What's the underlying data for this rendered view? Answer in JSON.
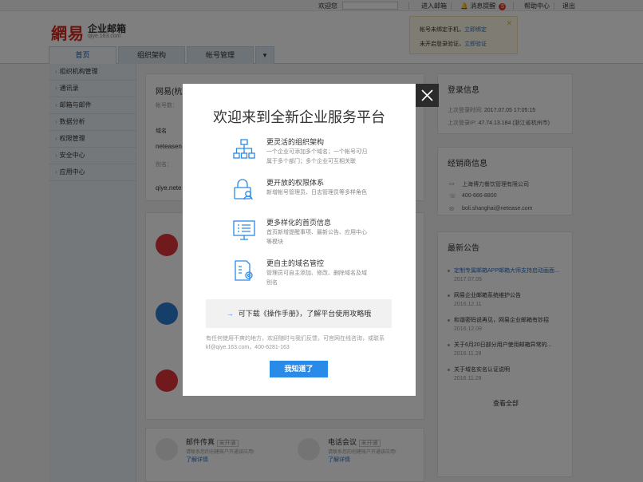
{
  "topbar": {
    "welcome": "欢迎您",
    "enter_mail": "进入邮箱",
    "messages": "消息提醒",
    "message_count": "5",
    "help": "帮助中心",
    "logout": "退出"
  },
  "logo": {
    "mark": "網易",
    "name": "企业邮箱",
    "domain": "qiye.163.com"
  },
  "notice": {
    "line1_text": "帐号未绑定手机，",
    "line1_link": "立即绑定",
    "line2_text": "未开启登录验证，",
    "line2_link": "立即验证",
    "close": "✕"
  },
  "nav": {
    "tabs": [
      "首页",
      "组织架构",
      "帐号管理"
    ],
    "more": "▾"
  },
  "sidebar": {
    "items": [
      {
        "label": "组织机构管理"
      },
      {
        "label": "通讯录"
      },
      {
        "label": "邮箱与邮件"
      },
      {
        "label": "数据分析"
      },
      {
        "label": "权限管理"
      },
      {
        "label": "安全中心"
      },
      {
        "label": "应用中心"
      }
    ]
  },
  "main": {
    "company_name": "网易(杭",
    "account_label": "帐号数：",
    "domain_label": "域名",
    "domain_value": "neteasen",
    "alias_label": "别名：",
    "qiye_text": "qiye.nete",
    "bottom_apps": [
      {
        "name": "邮件传真",
        "status": "未开通",
        "desc": "请联系您的创建账户开通该应用!",
        "link": "了解详情"
      },
      {
        "name": "电话会议",
        "status": "未开通",
        "desc": "请联系您的创建账户开通该应用!",
        "link": "了解详情"
      }
    ]
  },
  "login_info": {
    "title": "登录信息",
    "last_time_label": "上次登录时间: ",
    "last_time": "2017.07.05  17:05:15",
    "last_ip_label": "上次登录IP: ",
    "last_ip": "47.74.13.184 (浙江省杭州市)"
  },
  "dealer": {
    "title": "经销商信息",
    "company": "上海博力餐饮管理有限公司",
    "phone": "400-666-8800",
    "email": "boli.shanghai@netease.com"
  },
  "announcements": {
    "title": "最新公告",
    "items": [
      {
        "title": "定制专属邮箱APP邮箱大师支持启动画面...",
        "date": "2017.07.05",
        "highlight": true
      },
      {
        "title": "网易企业邮箱系统维护公告",
        "date": "2016.12.11",
        "highlight": false
      },
      {
        "title": "和谐密码说再见，网易企业邮箱有妙招",
        "date": "2016.12.09",
        "highlight": false
      },
      {
        "title": "关于6月20日部分用户使用邮箱异常的...",
        "date": "2016.11.28",
        "highlight": false
      },
      {
        "title": "关于域名实名认证说明",
        "date": "2016.11.28",
        "highlight": false
      }
    ],
    "view_all": "查看全部"
  },
  "modal": {
    "title": "欢迎来到全新企业服务平台",
    "close": "✕",
    "features": [
      {
        "icon": "org-structure-icon",
        "title": "更灵活的组织架构",
        "desc": "一个企业可添加多个域名；一个帐号可归属于多个部门；多个企业可互相关联"
      },
      {
        "icon": "permission-lock-icon",
        "title": "更开放的权限体系",
        "desc": "新增帐号管理员、日志管理员等多样角色"
      },
      {
        "icon": "homepage-list-icon",
        "title": "更多样化的首页信息",
        "desc": "首页新增提醒事项、最新公告、应用中心等模块"
      },
      {
        "icon": "domain-settings-icon",
        "title": "更自主的域名管控",
        "desc": "管理员可自主添加、修改、删除域名及域别名"
      }
    ],
    "download_arrow": "→",
    "download_text": "可下载《操作手册》，了解平台使用攻略哦",
    "contact": "有任何使用不爽的地方，欢迎随时与我们反馈，可官网在线咨询，或联系kf@qiye.163.com，400-6281-163",
    "ok_button": "我知道了"
  },
  "colors": {
    "accent": "#2a8ae8",
    "link": "#2a72c8",
    "logo_red": "#d52b1e",
    "overlay": "rgba(0,0,0,0.5)"
  }
}
